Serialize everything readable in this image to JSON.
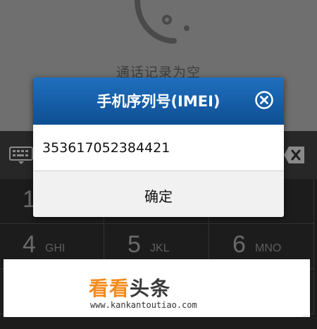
{
  "background": {
    "empty_text": "通话记录为空"
  },
  "dialpad": {
    "keys": [
      {
        "digit": "1",
        "letters": ""
      },
      {
        "digit": "",
        "letters": ""
      },
      {
        "digit": "",
        "letters": ""
      },
      {
        "digit": "4",
        "letters": "GHI"
      },
      {
        "digit": "5",
        "letters": "JKL"
      },
      {
        "digit": "6",
        "letters": "MNO"
      }
    ]
  },
  "dialog": {
    "title": "手机序列号(IMEI)",
    "imei": "353617052384421",
    "ok_label": "确定"
  },
  "watermark": {
    "brand_orange": "看看",
    "brand_dark": "头条",
    "url": "www.kankantoutiao.com",
    "corner": "..."
  },
  "colors": {
    "dialog_header": "#1a62ad",
    "brand_orange": "#f28b1d"
  }
}
